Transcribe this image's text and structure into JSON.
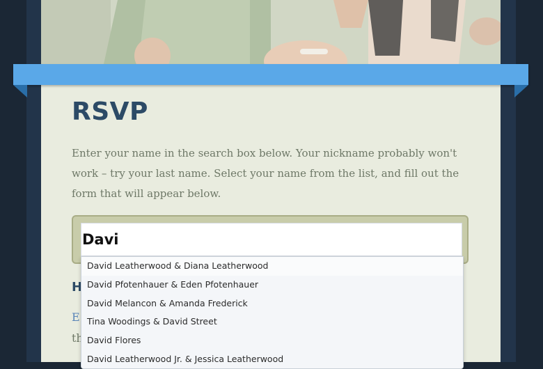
{
  "page": {
    "title": "RSVP",
    "intro": "Enter your name in the search box below. Your nickname probably won't work – try your last name. Select your name from the list, and fill out the form that will appear below."
  },
  "search": {
    "value": "Davi"
  },
  "suggestions": [
    "David Leatherwood & Diana Leatherwood",
    "David Pfotenhauer & Eden Pfotenhauer",
    "David Melancon & Amanda Frederick",
    "Tina Woodings & David Street",
    "David Flores",
    "David Leatherwood Jr. & Jessica Leatherwood"
  ],
  "partially_hidden": {
    "heading": "H",
    "line1": "E",
    "line2": "th"
  },
  "colors": {
    "background": "#1b2735",
    "card": "#e9ecdf",
    "ribbon": "#5aa8e8",
    "heading": "#2c4a66",
    "body_text": "#6e7867"
  }
}
